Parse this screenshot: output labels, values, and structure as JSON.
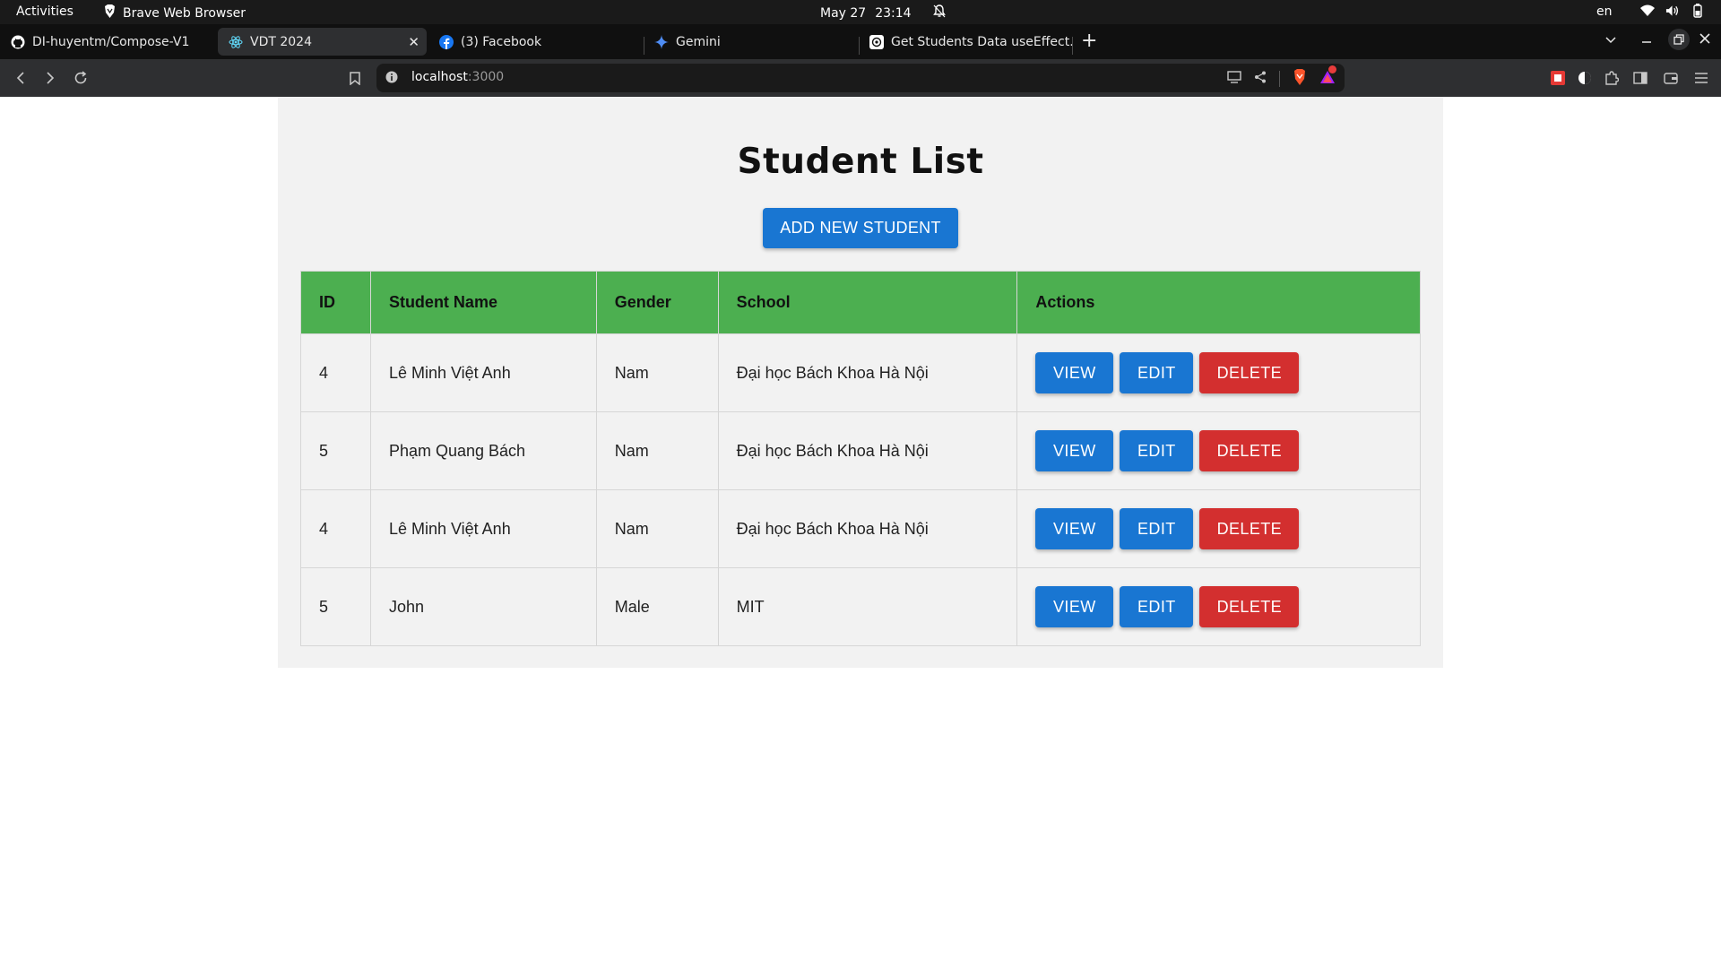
{
  "system_bar": {
    "activities": "Activities",
    "app_name": "Brave Web Browser",
    "date": "May 27",
    "time": "23:14",
    "language": "en"
  },
  "tabs": [
    {
      "title": "DI-huyentm/Compose-V1",
      "icon": "github-icon",
      "active": false
    },
    {
      "title": "VDT 2024",
      "icon": "react-icon",
      "active": true
    },
    {
      "title": "(3) Facebook",
      "icon": "facebook-icon",
      "active": false
    },
    {
      "title": "Gemini",
      "icon": "gemini-icon",
      "active": false
    },
    {
      "title": "Get Students Data useEffect.",
      "icon": "chatgpt-icon",
      "active": false
    }
  ],
  "address_bar": {
    "host": "localhost",
    "port": ":3000"
  },
  "page": {
    "title": "Student List",
    "add_button": "ADD NEW STUDENT"
  },
  "table": {
    "columns": [
      "ID",
      "Student Name",
      "Gender",
      "School",
      "Actions"
    ],
    "rows": [
      {
        "id": "4",
        "name": "Lê Minh Việt Anh",
        "gender": "Nam",
        "school": "Đại học Bách Khoa Hà Nội"
      },
      {
        "id": "5",
        "name": "Phạm Quang Bách",
        "gender": "Nam",
        "school": "Đại học Bách Khoa Hà Nội"
      },
      {
        "id": "4",
        "name": "Lê Minh Việt Anh",
        "gender": "Nam",
        "school": "Đại học Bách Khoa Hà Nội"
      },
      {
        "id": "5",
        "name": "John",
        "gender": "Male",
        "school": "MIT"
      }
    ],
    "actions": {
      "view": "VIEW",
      "edit": "EDIT",
      "delete": "DELETE"
    }
  },
  "colors": {
    "header_green": "#4caf50",
    "primary_blue": "#1976d2",
    "danger_red": "#d32f2f"
  }
}
